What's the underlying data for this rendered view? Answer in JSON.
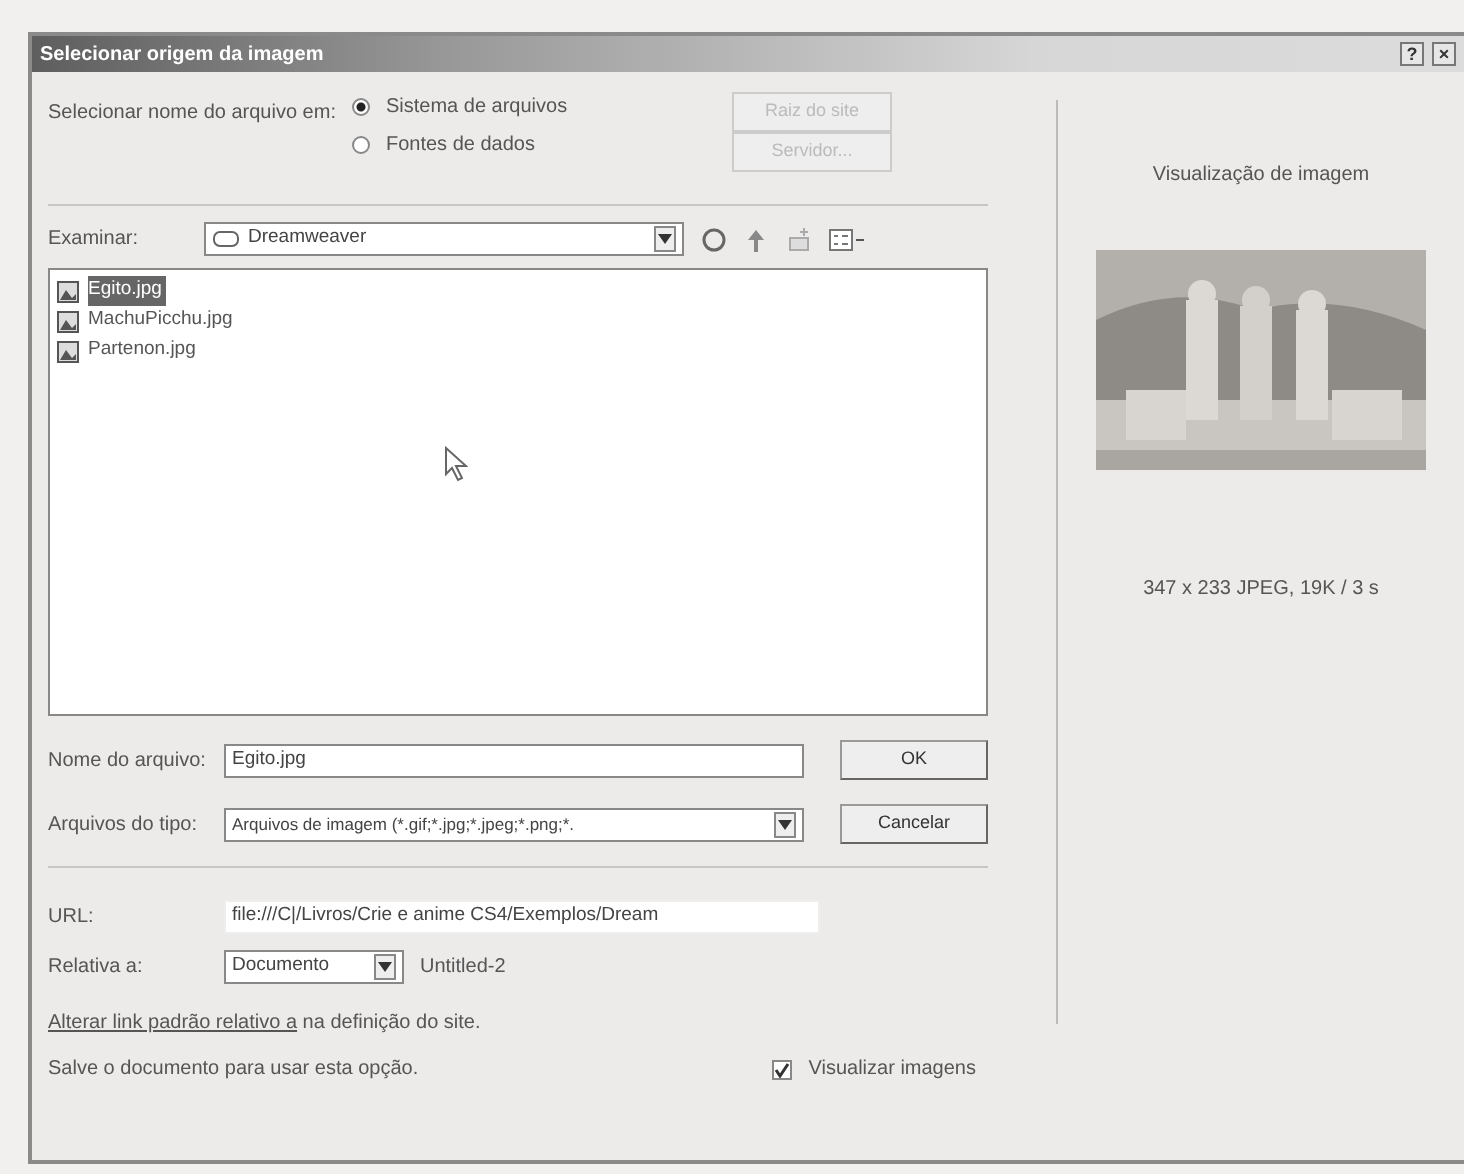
{
  "window": {
    "title": "Selecionar origem da imagem",
    "help_button": "?",
    "close_button": "×"
  },
  "source": {
    "label": "Selecionar nome do arquivo em:",
    "options": [
      {
        "label": "Sistema de arquivos",
        "selected": true
      },
      {
        "label": "Fontes de dados",
        "selected": false
      }
    ],
    "buttons": [
      {
        "label": "Raiz do site",
        "disabled": true
      },
      {
        "label": "Servidor...",
        "disabled": true
      }
    ]
  },
  "look_in": {
    "label": "Examinar:",
    "value": "Dreamweaver"
  },
  "files": [
    {
      "name": "Egito.jpg",
      "selected": true
    },
    {
      "name": "MachuPicchu.jpg",
      "selected": false
    },
    {
      "name": "Partenon.jpg",
      "selected": false
    }
  ],
  "file_name": {
    "label": "Nome do arquivo:",
    "value": "Egito.jpg"
  },
  "file_type": {
    "label": "Arquivos do tipo:",
    "value": "Arquivos de imagem (*.gif;*.jpg;*.jpeg;*.png;*."
  },
  "actions": [
    "OK",
    "Cancelar"
  ],
  "url": {
    "label": "URL:",
    "value": "file:///C|/Livros/Crie e anime CS4/Exemplos/Dream"
  },
  "relative": {
    "label": "Relativa a:",
    "value": "Documento",
    "note": "Untitled-2"
  },
  "site_note": {
    "link": "Alterar link padrão relativo a",
    "text": " na definição do site."
  },
  "save_note": "Salve o documento para usar esta opção.",
  "preview_toggle": {
    "label": "Visualizar imagens",
    "checked": true
  },
  "preview": {
    "title": "Visualização de imagem",
    "caption": "347 x 233 JPEG, 19K / 3 s"
  }
}
